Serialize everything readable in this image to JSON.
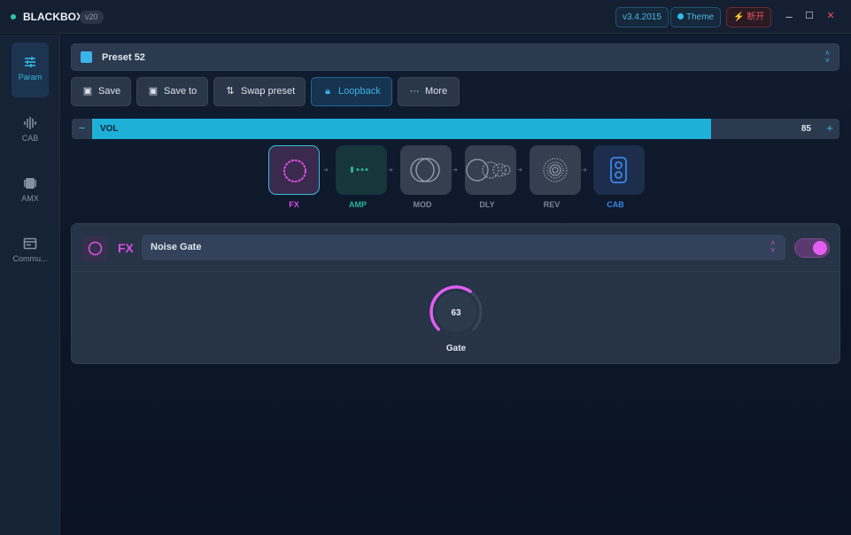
{
  "app": {
    "title": "BLACKBOX",
    "badge": "v20",
    "version": "v3.4.2015",
    "theme_label": "Theme",
    "disconnect_label": "断开"
  },
  "window": {
    "minimize": "–",
    "maximize": "☐",
    "close": "✕"
  },
  "sidebar": {
    "items": [
      {
        "label": "Param",
        "active": true
      },
      {
        "label": "CAB"
      },
      {
        "label": "AMX"
      },
      {
        "label": "Commu..."
      }
    ]
  },
  "preset": {
    "name": "Preset 52"
  },
  "toolbar": {
    "save": "Save",
    "save_to": "Save to",
    "swap": "Swap preset",
    "loopback": "Loopback",
    "more": "More"
  },
  "volume": {
    "label": "VOL",
    "value": 85,
    "value_text": "85",
    "minus": "−",
    "plus": "+"
  },
  "chain": [
    {
      "label": "FX",
      "color": "#d94fe0"
    },
    {
      "label": "AMP",
      "color": "#2bb59a"
    },
    {
      "label": "MOD",
      "color": "#7d8796"
    },
    {
      "label": "DLY",
      "color": "#7d8796"
    },
    {
      "label": "REV",
      "color": "#7d8796"
    },
    {
      "label": "CAB",
      "color": "#3a86e8"
    }
  ],
  "effect": {
    "type": "FX",
    "name": "Noise Gate",
    "enabled": true,
    "knob": {
      "label": "Gate",
      "value": 63,
      "value_text": "63"
    }
  },
  "colors": {
    "accent": "#1fb0d8",
    "fx": "#d94fe0"
  }
}
